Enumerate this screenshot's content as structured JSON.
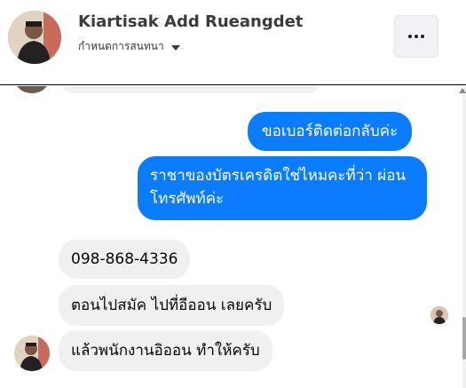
{
  "contact": {
    "name": "Kiartisak Add Rueangdet",
    "subtitle": "กำหนดการสนทนา"
  },
  "header": {
    "more_icon": "more-horizontal-icon"
  },
  "messages": [
    {
      "direction": "out",
      "text": "ขอเบอร์ติดต่อกลับค่ะ"
    },
    {
      "direction": "out",
      "text": "ราชาของบัตรเครดิตใช่ไหมคะที่ว่า ผ่อนโทรศัพท์ค่ะ"
    },
    {
      "direction": "in",
      "text": "098-868-4336"
    },
    {
      "direction": "in",
      "text": "ตอนไปสมัค ไปที่อีออน เลยครับ"
    },
    {
      "direction": "in",
      "text": "แล้วพนักงานอิออน ทำให้ครับ"
    }
  ],
  "colors": {
    "outgoing_bubble": "#0a7cff",
    "incoming_bubble": "#f0f0f0",
    "text_dark": "#050505"
  }
}
